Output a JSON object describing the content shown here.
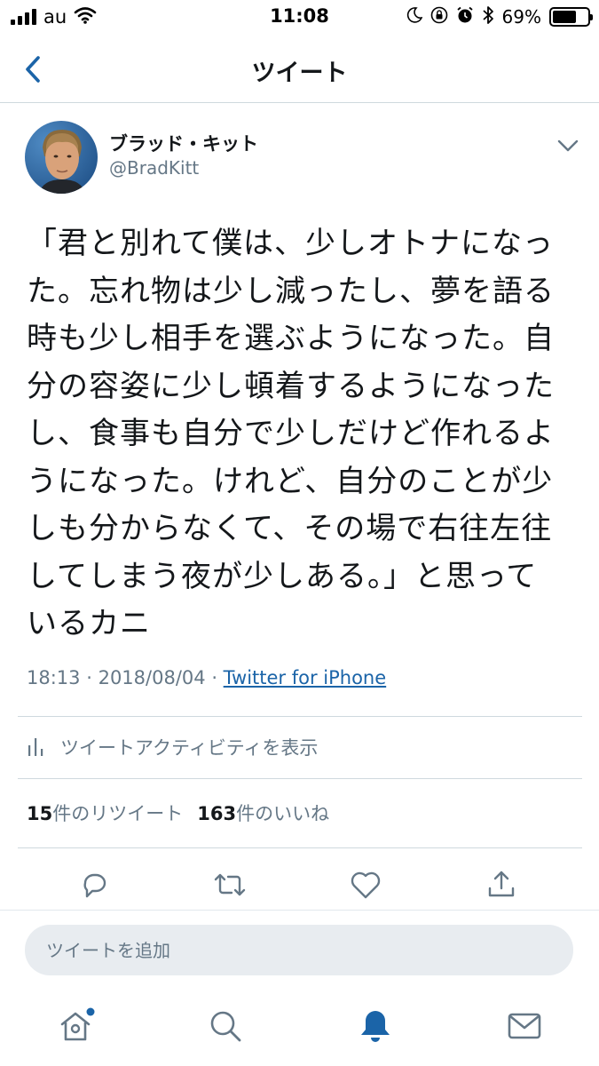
{
  "status_bar": {
    "carrier": "au",
    "time": "11:08",
    "battery_percent": "69%",
    "battery_level": 0.69
  },
  "nav": {
    "title": "ツイート",
    "back_icon": "chevron-left-icon"
  },
  "tweet": {
    "author": {
      "display_name": "ブラッド・キット",
      "handle": "@BradKitt"
    },
    "text_lines": [
      "「君と別れて僕は、少しオトナになっ",
      "た。忘れ物は少し減ったし、夢を語る",
      "時も少し相手を選ぶようになった。自",
      "分の容姿に少し頓着するようになった",
      "し、食事も自分で少しだけど作れるよ",
      "うになった。けれど、自分のことが少",
      "しも分からなくて、その場で右往左往",
      "してしまう夜が少しある。」と思って",
      "いるカニ"
    ],
    "time": "18:13",
    "date": "2018/08/04",
    "source": "Twitter for iPhone"
  },
  "activity": {
    "label": "ツイートアクティビティを表示"
  },
  "stats": {
    "retweet_count": "15",
    "retweet_label": "件のリツイート",
    "like_count": "163",
    "like_label": "件のいいね"
  },
  "actions": [
    "reply-icon",
    "retweet-icon",
    "like-icon",
    "share-icon"
  ],
  "compose": {
    "placeholder": "ツイートを追加"
  },
  "tab_bar": [
    "home-icon",
    "search-icon",
    "notifications-icon",
    "messages-icon"
  ],
  "colors": {
    "accent": "#1da1f2",
    "active_tab": "#1b64a8",
    "secondary_text": "#657786",
    "divider": "#cfd9de"
  }
}
